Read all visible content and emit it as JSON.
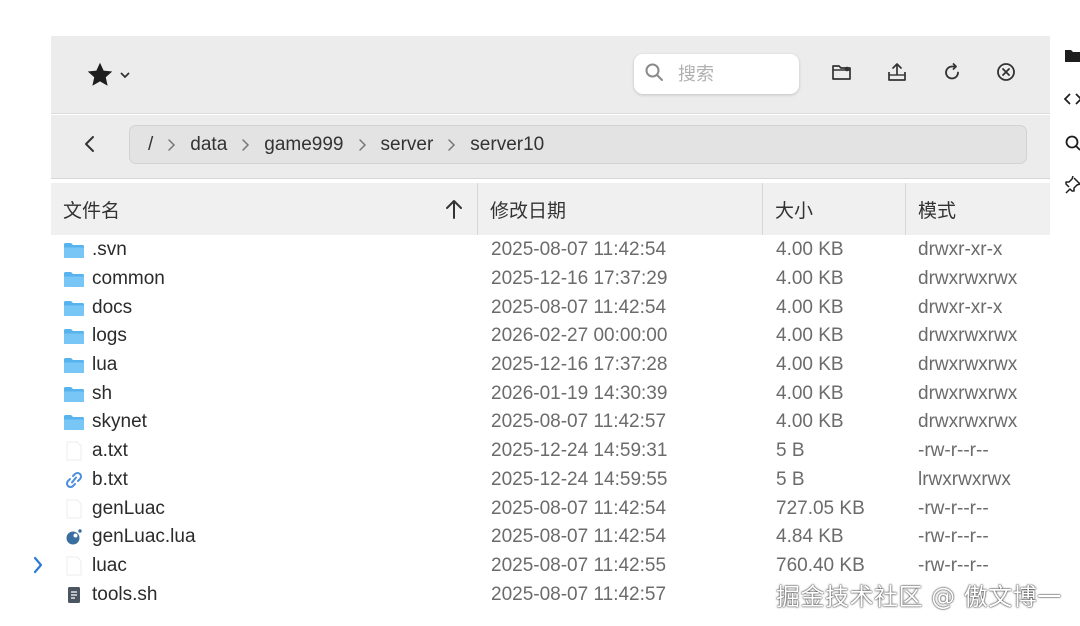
{
  "toolbar": {
    "favorites_icon": "star-icon",
    "search_placeholder": "搜索",
    "buttons": [
      "new-folder-icon",
      "upload-icon",
      "refresh-icon",
      "close-icon"
    ]
  },
  "path": {
    "segments": [
      "/",
      "data",
      "game999",
      "server",
      "server10"
    ]
  },
  "table": {
    "headers": [
      "文件名",
      "修改日期",
      "大小",
      "模式"
    ],
    "sort_column": "文件名",
    "sort_direction": "ascending",
    "rows": [
      {
        "icon": "folder-icon",
        "name": ".svn",
        "date": "2025-08-07 11:42:54",
        "size": "4.00 KB",
        "mode": "drwxr-xr-x"
      },
      {
        "icon": "folder-icon",
        "name": "common",
        "date": "2025-12-16 17:37:29",
        "size": "4.00 KB",
        "mode": "drwxrwxrwx"
      },
      {
        "icon": "folder-icon",
        "name": "docs",
        "date": "2025-08-07 11:42:54",
        "size": "4.00 KB",
        "mode": "drwxr-xr-x"
      },
      {
        "icon": "folder-icon",
        "name": "logs",
        "date": "2026-02-27 00:00:00",
        "size": "4.00 KB",
        "mode": "drwxrwxrwx"
      },
      {
        "icon": "folder-icon",
        "name": "lua",
        "date": "2025-12-16 17:37:28",
        "size": "4.00 KB",
        "mode": "drwxrwxrwx"
      },
      {
        "icon": "folder-icon",
        "name": "sh",
        "date": "2026-01-19 14:30:39",
        "size": "4.00 KB",
        "mode": "drwxrwxrwx"
      },
      {
        "icon": "folder-icon",
        "name": "skynet",
        "date": "2025-08-07 11:42:57",
        "size": "4.00 KB",
        "mode": "drwxrwxrwx"
      },
      {
        "icon": "file-icon",
        "name": "a.txt",
        "date": "2025-12-24 14:59:31",
        "size": "5 B",
        "mode": "-rw-r--r--"
      },
      {
        "icon": "link-icon",
        "name": "b.txt",
        "date": "2025-12-24 14:59:55",
        "size": "5 B",
        "mode": "lrwxrwxrwx"
      },
      {
        "icon": "file-icon",
        "name": "genLuac",
        "date": "2025-08-07 11:42:54",
        "size": "727.05 KB",
        "mode": "-rw-r--r--"
      },
      {
        "icon": "lua-icon",
        "name": "genLuac.lua",
        "date": "2025-08-07 11:42:54",
        "size": "4.84 KB",
        "mode": "-rw-r--r--"
      },
      {
        "icon": "file-icon",
        "name": "luac",
        "date": "2025-08-07 11:42:55",
        "size": "760.40 KB",
        "mode": "-rw-r--r--"
      },
      {
        "icon": "script-icon",
        "name": "tools.sh",
        "date": "2025-08-07 11:42:57",
        "size": "",
        "mode": ""
      }
    ]
  },
  "sidebar_right": [
    "folder-icon",
    "code-icon",
    "search-icon",
    "pin-icon"
  ],
  "watermark": "掘金技术社区 @ 傲文博一",
  "colors": {
    "folder": "#6cc1f2",
    "accent": "#2d7ad6",
    "toolbar_bg": "#ececec"
  }
}
